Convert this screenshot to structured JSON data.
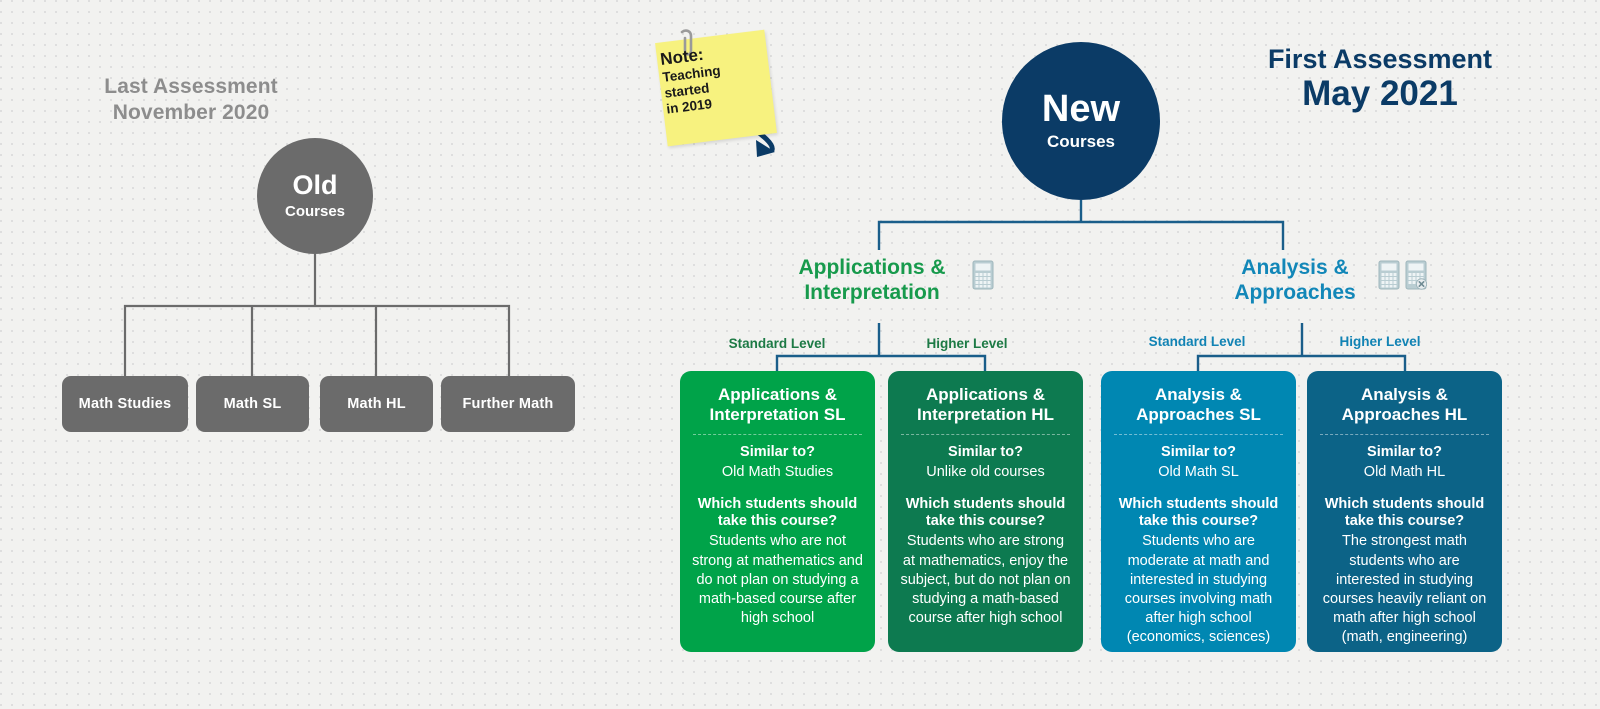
{
  "left": {
    "heading_line1": "Last Assessment",
    "heading_line2": "November 2020",
    "circle": {
      "big": "Old",
      "small": "Courses"
    },
    "boxes": [
      {
        "label": "Math Studies"
      },
      {
        "label": "Math SL"
      },
      {
        "label": "Math HL"
      },
      {
        "label": "Further Math"
      }
    ]
  },
  "note": {
    "title": "Note:",
    "line1": "Teaching",
    "line2": "started",
    "line3": "in 2019"
  },
  "right": {
    "circle": {
      "big": "New",
      "small": "Courses"
    },
    "heading_line1": "First Assessment",
    "heading_line2": "May 2021",
    "branches": [
      {
        "title_line1": "Applications &",
        "title_line2": "Interpretation",
        "color": "#179a4c",
        "calculators": [
          "calculator-icon"
        ],
        "levels": [
          "Standard Level",
          "Higher Level"
        ]
      },
      {
        "title_line1": "Analysis &",
        "title_line2": "Approaches",
        "color": "#1287b8",
        "calculators": [
          "calculator-icon",
          "calculator-disallowed-icon"
        ],
        "levels": [
          "Standard Level",
          "Higher Level"
        ]
      }
    ],
    "cards": [
      {
        "title_line1": "Applications &",
        "title_line2": "Interpretation SL",
        "bg": "#00a349",
        "similar_q": "Similar to?",
        "similar_a": "Old Math Studies",
        "which_q_line1": "Which students should",
        "which_q_line2": "take this course?",
        "which_a": "Students who are not strong at mathematics and do not plan on studying a math-based course after high school"
      },
      {
        "title_line1": "Applications &",
        "title_line2": "Interpretation HL",
        "bg": "#0d7a50",
        "similar_q": "Similar to?",
        "similar_a": "Unlike old courses",
        "which_q_line1": "Which students should",
        "which_q_line2": "take this course?",
        "which_a": "Students who are strong at mathematics, enjoy the subject, but do not plan on studying a math-based course after high school"
      },
      {
        "title_line1": "Analysis &",
        "title_line2": "Approaches SL",
        "bg": "#0087b2",
        "similar_q": "Similar to?",
        "similar_a": "Old Math SL",
        "which_q_line1": "Which students should",
        "which_q_line2": "take this course?",
        "which_a": "Students who are moderate at math and interested in studying courses involving math after high school (economics, sciences)"
      },
      {
        "title_line1": "Analysis &",
        "title_line2": "Approaches HL",
        "bg": "#0c6387",
        "similar_q": "Similar to?",
        "similar_a": "Old Math HL",
        "which_q_line1": "Which students should",
        "which_q_line2": "take this course?",
        "which_a": "The strongest math students who are interested in studying courses heavily reliant on math after high school (math, engineering)"
      }
    ]
  },
  "colors": {
    "background": "#f2f2f0",
    "old_gray": "#6b6b6b",
    "navy": "#0b3b66",
    "green": "#179a4c",
    "blue": "#1287b8"
  }
}
